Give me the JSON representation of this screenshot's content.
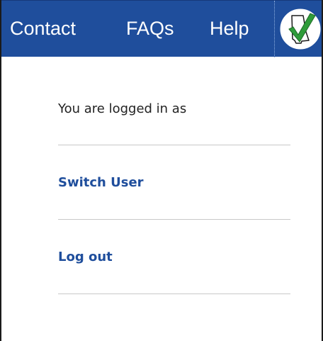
{
  "nav": {
    "links": [
      "Contact",
      "FAQs",
      "Help"
    ]
  },
  "user_menu": {
    "logged_in_text": "You are logged in as",
    "switch_user": "Switch User",
    "log_out": "Log out"
  },
  "colors": {
    "nav_background": "#1f4e9c",
    "link": "#1f4e9c",
    "divider": "#c8c8c8",
    "logo_check": "#2f9c3a"
  },
  "icons": {
    "logo": "state-checkmark-logo-icon"
  }
}
